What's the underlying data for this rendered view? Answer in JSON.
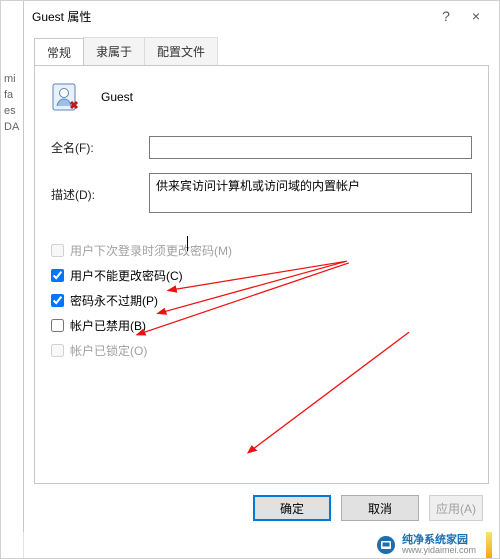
{
  "window": {
    "title": "Guest 属性",
    "help_tip": "?",
    "close_tip": "×"
  },
  "tabs": {
    "general": "常规",
    "member_of": "隶属于",
    "profile": "配置文件"
  },
  "identity": {
    "name": "Guest"
  },
  "fields": {
    "full_name_label": "全名(F):",
    "full_name_value": "",
    "description_label": "描述(D):",
    "description_value": "供来宾访问计算机或访问域的内置帐户"
  },
  "checkboxes": {
    "must_change": "用户下次登录时须更改密码(M)",
    "cannot_change": "用户不能更改密码(C)",
    "never_expires": "密码永不过期(P)",
    "disabled": "帐户已禁用(B)",
    "locked": "帐户已锁定(O)"
  },
  "buttons": {
    "ok": "确定",
    "cancel": "取消",
    "apply": "应用(A)"
  },
  "left_slice": {
    "l1": "mi",
    "l2": "fa",
    "l3": "es",
    "l4": "DA"
  },
  "watermark": {
    "line1": "纯净系统家园",
    "line2": "www.yidaimei.com"
  }
}
